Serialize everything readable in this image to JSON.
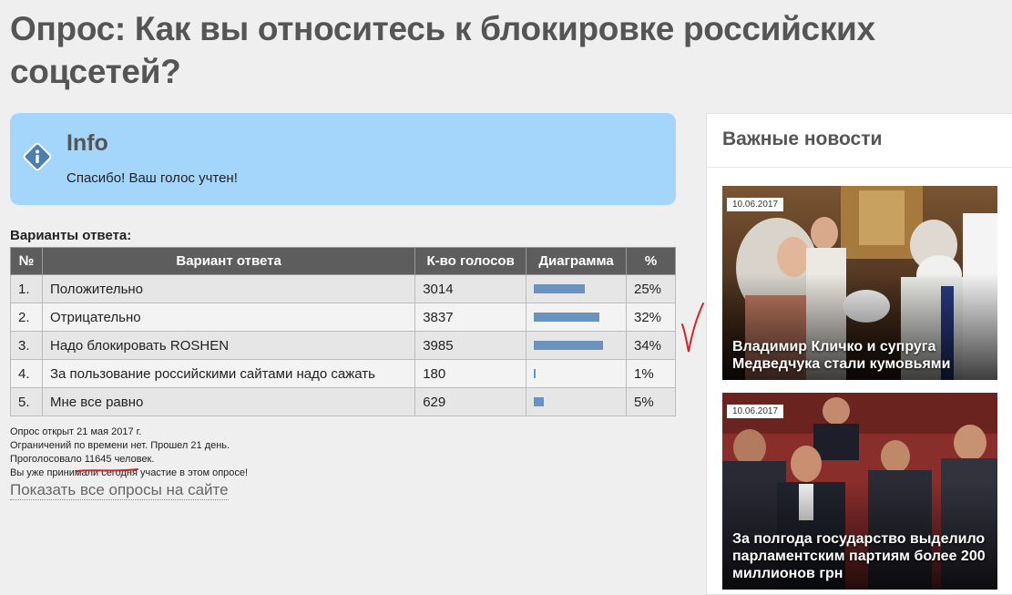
{
  "page": {
    "title": "Опрос: Как вы относитесь к блокировке российских соцсетей?"
  },
  "info": {
    "title": "Info",
    "message": "Спасибо! Ваш голос учтен!"
  },
  "results": {
    "heading": "Варианты ответа:",
    "columns": [
      "№",
      "Вариант ответа",
      "К-во голосов",
      "Диаграмма",
      "%"
    ],
    "rows": [
      {
        "num": "1.",
        "option": "Положительно",
        "votes": "3014",
        "percent": "25%",
        "share": 0.25
      },
      {
        "num": "2.",
        "option": "Отрицательно",
        "votes": "3837",
        "percent": "32%",
        "share": 0.32
      },
      {
        "num": "3.",
        "option": "Надо блокировать ROSHEN",
        "votes": "3985",
        "percent": "34%",
        "share": 0.34
      },
      {
        "num": "4.",
        "option": "За пользование российскими сайтами надо сажать",
        "votes": "180",
        "percent": "1%",
        "share": 0.01
      },
      {
        "num": "5.",
        "option": "Мне все равно",
        "votes": "629",
        "percent": "5%",
        "share": 0.05
      }
    ]
  },
  "meta": {
    "opened": "Опрос открыт 21 мая 2017 г.",
    "limits": "Ограничений по времени нет. Прошел 21 день.",
    "voted_prefix": "Проголосовало ",
    "voted_count": "11645 человек.",
    "participated": "Вы уже принимали сегодня участие в этом опросе!",
    "all_polls_link": "Показать все опросы на сайте"
  },
  "sidebar": {
    "title": "Важные новости",
    "news": [
      {
        "date": "10.06.2017",
        "headline": "Владимир Кличко и супруга Медведчука стали кумовьями"
      },
      {
        "date": "10.06.2017",
        "headline": "За полгода государство выделило парламентским партиям более 200 миллионов грн"
      }
    ]
  },
  "colors": {
    "info_bg": "#a4d5fb",
    "table_header": "#5d5d5d",
    "bar": "#6a93bd",
    "annotation_red": "#e02020"
  }
}
